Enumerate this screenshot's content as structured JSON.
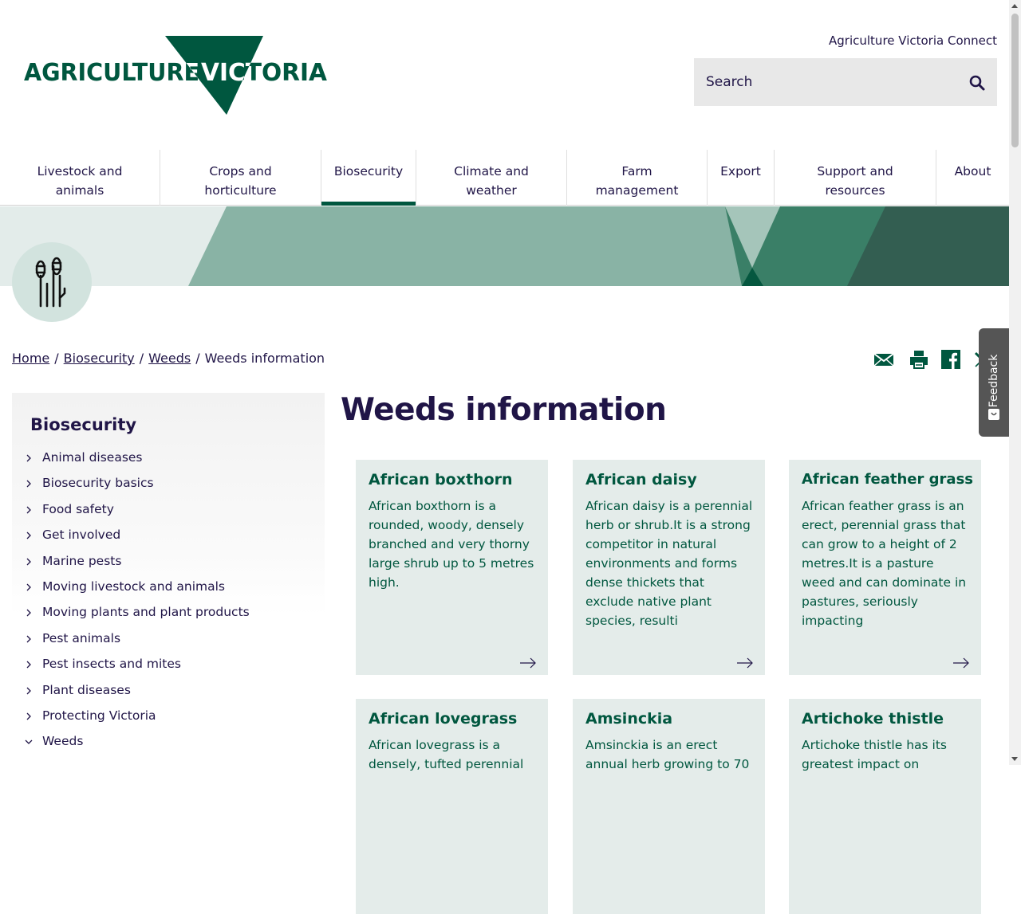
{
  "header": {
    "logo_text": "AGRICULTURE VICTORIA",
    "logo_word1": "AGRICULTURE",
    "logo_word2": "VICTORIA",
    "connect_link": "Agriculture Victoria Connect",
    "search_placeholder": "Search"
  },
  "nav": {
    "items": [
      {
        "label": "Livestock and animals"
      },
      {
        "label": "Crops and horticulture"
      },
      {
        "label": "Biosecurity",
        "active": true
      },
      {
        "label": "Climate and weather"
      },
      {
        "label": "Farm management"
      },
      {
        "label": "Export"
      },
      {
        "label": "Support and resources"
      },
      {
        "label": "About"
      }
    ]
  },
  "hero": {
    "icon": "wheat-icon"
  },
  "breadcrumb": {
    "items": [
      "Home",
      "Biosecurity",
      "Weeds"
    ],
    "current": "Weeds information",
    "separator": "/"
  },
  "share": {
    "icons": [
      "email-icon",
      "print-icon",
      "facebook-icon",
      "x-icon"
    ]
  },
  "feedback": {
    "label": "Feedback"
  },
  "sidebar": {
    "title": "Biosecurity",
    "items": [
      {
        "label": "Animal diseases"
      },
      {
        "label": "Biosecurity basics"
      },
      {
        "label": "Food safety"
      },
      {
        "label": "Get involved"
      },
      {
        "label": "Marine pests"
      },
      {
        "label": "Moving livestock and animals"
      },
      {
        "label": "Moving plants and plant products"
      },
      {
        "label": "Pest animals"
      },
      {
        "label": "Pest insects and mites"
      },
      {
        "label": "Plant diseases"
      },
      {
        "label": "Protecting Victoria"
      },
      {
        "label": "Weeds",
        "expanded": true
      }
    ]
  },
  "main": {
    "title": "Weeds information",
    "cards": [
      {
        "title": "African boxthorn",
        "description": "African boxthorn is a rounded, woody, densely branched and very thorny large shrub up to 5 metres high."
      },
      {
        "title": "African daisy",
        "description": "African daisy is a perennial herb or shrub.It is a strong competitor in natural environments and forms dense thickets that exclude native plant species, resulti"
      },
      {
        "title": "African feather grass",
        "description": "African feather grass is an erect, perennial grass that can grow to a height of 2 metres.It is a pasture weed and can dominate in pastures, seriously impacting"
      },
      {
        "title": "African lovegrass",
        "description": "African lovegrass is a densely, tufted perennial"
      },
      {
        "title": "Amsinckia",
        "description": "Amsinckia is an erect annual herb growing to 70"
      },
      {
        "title": "Artichoke thistle",
        "description": "Artichoke thistle has its greatest impact on"
      }
    ]
  },
  "colors": {
    "brand_green": "#00573f",
    "text_navy": "#201547",
    "card_bg": "#e4ecea"
  }
}
